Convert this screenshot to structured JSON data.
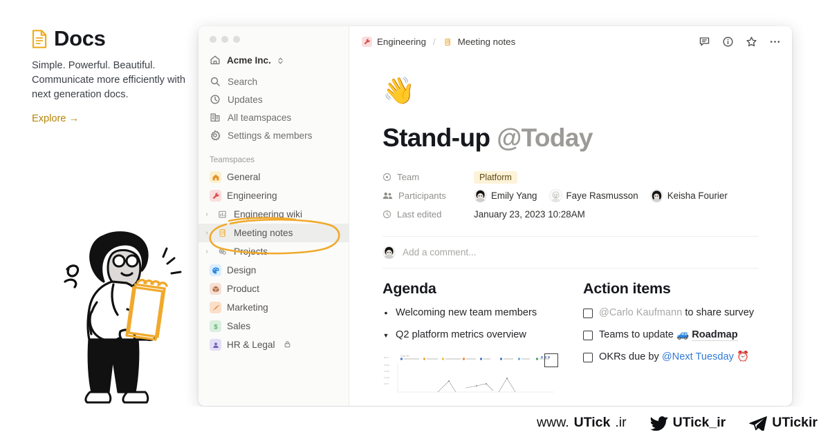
{
  "promo": {
    "icon": "document-icon",
    "title": "Docs",
    "description": "Simple. Powerful. Beautiful. Communicate more efficiently with next generation docs.",
    "link": "Explore →"
  },
  "sidebar": {
    "workspace": "Acme Inc.",
    "nav": [
      {
        "label": "Search",
        "icon": "search-icon"
      },
      {
        "label": "Updates",
        "icon": "clock-icon"
      },
      {
        "label": "All teamspaces",
        "icon": "buildings-icon"
      },
      {
        "label": "Settings & members",
        "icon": "gear-icon"
      }
    ],
    "section_title": "Teamspaces",
    "teamspaces": [
      {
        "label": "General",
        "icon": "house-emoji",
        "caret": false,
        "selected": false
      },
      {
        "label": "Engineering",
        "icon": "wrench-emoji",
        "caret": false,
        "selected": false
      },
      {
        "label": "Engineering wiki",
        "icon": "chart-book-emoji",
        "caret": true,
        "selected": false
      },
      {
        "label": "Meeting notes",
        "icon": "notebook-emoji",
        "caret": true,
        "selected": true
      },
      {
        "label": "Projects",
        "icon": "gears-emoji",
        "caret": true,
        "selected": false
      },
      {
        "label": "Design",
        "icon": "palette-emoji",
        "caret": false,
        "selected": false
      },
      {
        "label": "Product",
        "icon": "package-emoji",
        "caret": false,
        "selected": false
      },
      {
        "label": "Marketing",
        "icon": "megaphone-emoji",
        "caret": false,
        "selected": false
      },
      {
        "label": "Sales",
        "icon": "dollar-emoji",
        "caret": false,
        "selected": false
      },
      {
        "label": "HR & Legal",
        "icon": "person-emoji",
        "caret": false,
        "selected": false,
        "lock": "🔒"
      }
    ]
  },
  "doc": {
    "breadcrumb": {
      "parent": "Engineering",
      "separator": "/",
      "current": "Meeting notes"
    },
    "actions": [
      "comment-icon",
      "info-icon",
      "star-icon",
      "more-icon"
    ],
    "cover_emoji": "👋",
    "title_main": "Stand-up ",
    "title_mention": "@Today",
    "properties": [
      {
        "key": "Team",
        "icon": "target-icon",
        "value": "Platform",
        "type": "chip"
      },
      {
        "key": "Participants",
        "icon": "people-icon",
        "type": "people",
        "people": [
          "Emily Yang",
          "Faye Rasmusson",
          "Keisha Fourier"
        ]
      },
      {
        "key": "Last edited",
        "icon": "clock-icon",
        "value": "January 23, 2023 10:28AM",
        "type": "text"
      }
    ],
    "comment_placeholder": "Add a comment...",
    "columns": [
      {
        "heading": "Agenda",
        "items": [
          {
            "marker": "•",
            "text": "Welcoming new team members"
          },
          {
            "marker": "▼",
            "text": "Q2 platform metrics overview"
          }
        ]
      },
      {
        "heading": "Action items",
        "items": [
          {
            "marker": "checkbox",
            "mention": "@Carlo Kaufmann",
            "mention_style": "grey",
            "text": " to share survey"
          },
          {
            "marker": "checkbox",
            "text": "Teams to update ",
            "link_icon": "🚙",
            "link": "Roadmap"
          },
          {
            "marker": "checkbox",
            "text": "OKRs due by ",
            "mention": "@Next Tuesday",
            "mention_style": "blue",
            "suffix_icon": "⏰"
          }
        ]
      }
    ]
  },
  "footer": {
    "website_prefix": "www.",
    "website_brand": "UTick",
    "website_suffix": ".ir",
    "twitter_handle": "UTick_ir",
    "telegram_handle": "UTickir"
  },
  "colors": {
    "accent_yellow": "#e9a01b",
    "annotation": "#f0a92c",
    "mention_blue": "#3279d6",
    "link_gold": "#b5860b"
  }
}
